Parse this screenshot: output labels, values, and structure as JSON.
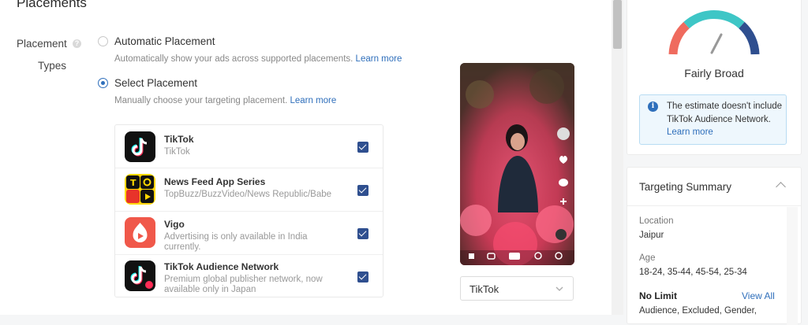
{
  "section": {
    "title": "Placements"
  },
  "placement_types": {
    "label_line1": "Placement",
    "label_line2": "Types",
    "automatic": {
      "title": "Automatic Placement",
      "desc": "Automatically show your ads across supported placements.",
      "link": "Learn more",
      "selected": false
    },
    "select": {
      "title": "Select Placement",
      "desc": "Manually choose your targeting placement.",
      "link": "Learn more",
      "selected": true
    }
  },
  "placements": [
    {
      "name": "TikTok",
      "sub": "TikTok",
      "icon": "tiktok-logo-icon",
      "checked": true
    },
    {
      "name": "News Feed App Series",
      "sub": "TopBuzz/BuzzVideo/News Republic/Babe",
      "icon": "news-feed-logo-icon",
      "checked": true
    },
    {
      "name": "Vigo",
      "sub": "Advertising is only available in India currently.",
      "icon": "vigo-logo-icon",
      "checked": true
    },
    {
      "name": "TikTok Audience Network",
      "sub": "Premium global publisher network, now available only in Japan",
      "icon": "tiktok-audience-network-logo-icon",
      "checked": true
    }
  ],
  "preview": {
    "selected_app": "TikTok"
  },
  "audience_gauge": {
    "label": "Fairly Broad",
    "info": "The estimate doesn't include TikTok Audience Network.",
    "info_link": "Learn more",
    "colors": {
      "red": "#ef6b5e",
      "teal": "#3ec6c6",
      "blue": "#2f4f8f"
    }
  },
  "targeting_summary": {
    "title": "Targeting Summary",
    "location_label": "Location",
    "location_value": "Jaipur",
    "age_label": "Age",
    "age_value": "18-24, 35-44, 45-54, 25-34",
    "no_limit_label": "No Limit",
    "view_all": "View All",
    "no_limit_value": "Audience, Excluded, Gender,"
  }
}
